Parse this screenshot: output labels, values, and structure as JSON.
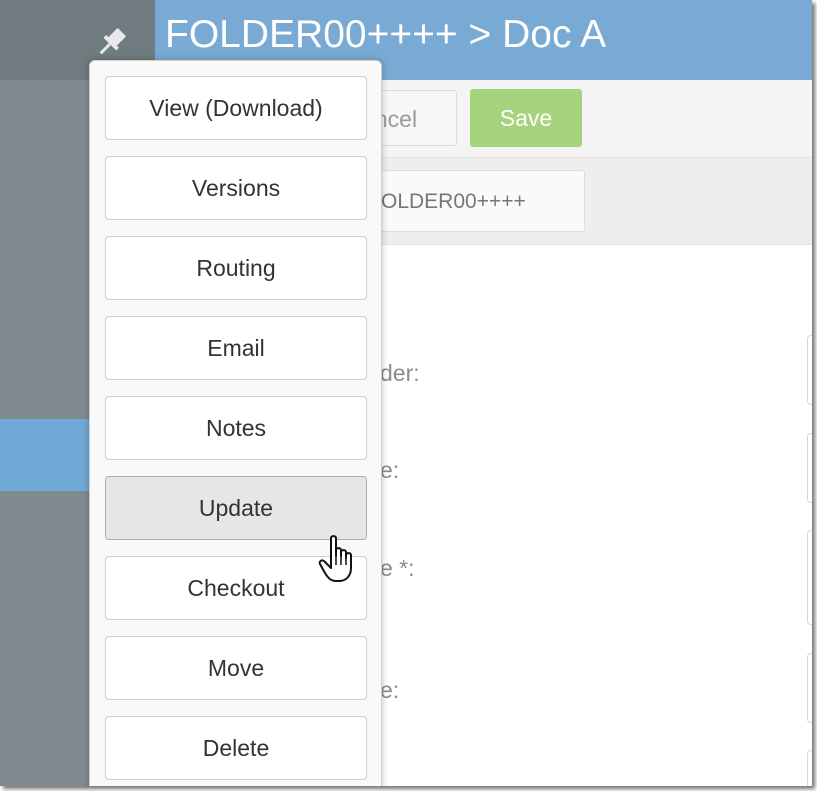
{
  "header": {
    "title": "FOLDER00++++ > Doc A"
  },
  "toolbar": {
    "cancel_label": "ncel",
    "save_label": "Save"
  },
  "breadcrumb": {
    "label": "OLDER00++++"
  },
  "form": {
    "labels": [
      "der:",
      "e:",
      "e *:",
      "e:"
    ]
  },
  "menu": {
    "items": [
      {
        "label": "View (Download)"
      },
      {
        "label": "Versions"
      },
      {
        "label": "Routing"
      },
      {
        "label": "Email"
      },
      {
        "label": "Notes"
      },
      {
        "label": "Update"
      },
      {
        "label": "Checkout"
      },
      {
        "label": "Move"
      },
      {
        "label": "Delete"
      }
    ],
    "hovered": "Update"
  },
  "colors": {
    "header_bg": "#78aad3",
    "sidebar_bg": "#7f8b8e",
    "sidebar_active": "#6fa8d4",
    "save_button": "#a6d37d"
  },
  "icons": {
    "pin": "pin-icon",
    "cursor": "hand-pointer-icon"
  }
}
